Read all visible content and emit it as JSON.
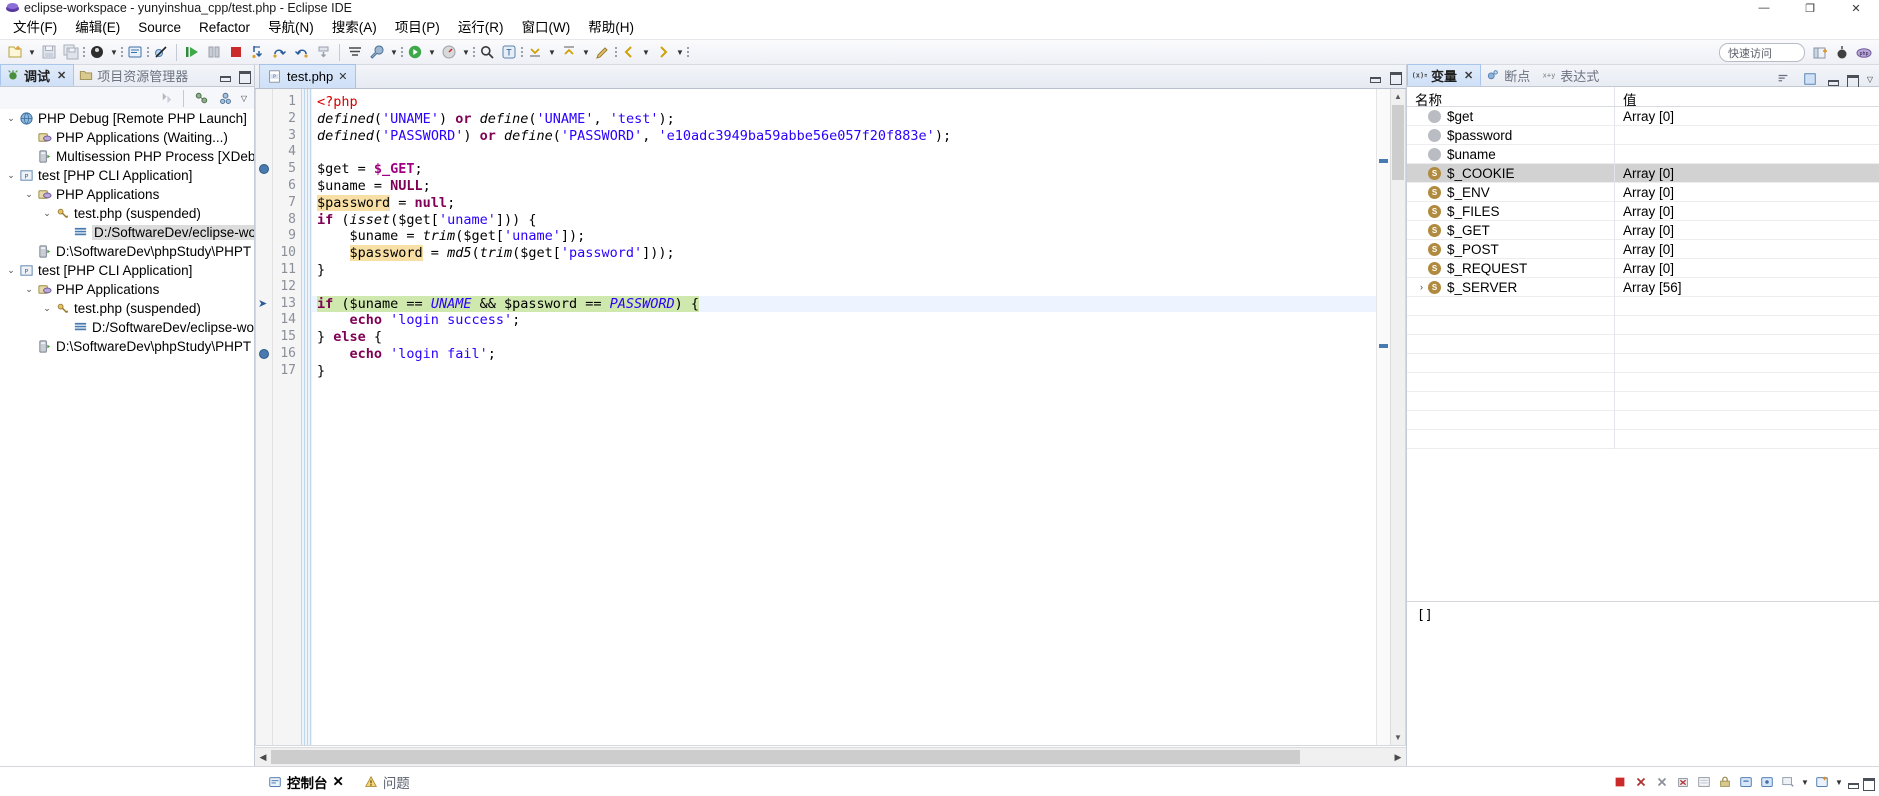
{
  "window": {
    "title": "eclipse-workspace - yunyinshua_cpp/test.php - Eclipse IDE",
    "minimize_label": "—",
    "maximize_label": "❐",
    "close_label": "✕"
  },
  "menu": {
    "items": [
      {
        "label": "文件(F)"
      },
      {
        "label": "编辑(E)"
      },
      {
        "label": "Source"
      },
      {
        "label": "Refactor"
      },
      {
        "label": "导航(N)"
      },
      {
        "label": "搜索(A)"
      },
      {
        "label": "项目(P)"
      },
      {
        "label": "运行(R)"
      },
      {
        "label": "窗口(W)"
      },
      {
        "label": "帮助(H)"
      }
    ]
  },
  "toolbar": {
    "quick_access": "快速访问",
    "icons": [
      "new-wizard-icon",
      "new-dropdown-icon",
      "save-icon",
      "save-all-icon",
      "debug-icon",
      "debug-dropdown-icon",
      "open-console-icon",
      "skip-breakpoints-icon",
      "resume-icon",
      "suspend-icon",
      "terminate-icon",
      "step-into-icon",
      "step-over-icon",
      "step-return-icon",
      "drop-to-frame-icon",
      "use-step-filters-icon",
      "run-icon",
      "external-tools-icon",
      "search-icon",
      "open-type-icon",
      "next-annotation-icon",
      "previous-annotation-icon",
      "last-edit-location-icon",
      "back-icon",
      "forward-icon",
      "pin-editor-icon"
    ]
  },
  "debug_view": {
    "tabs": [
      {
        "label": "调试",
        "icon": "bug-icon",
        "active": true,
        "closeable": true
      },
      {
        "label": "项目资源管理器",
        "icon": "project-explorer-icon",
        "active": false,
        "closeable": false
      }
    ],
    "tree": [
      {
        "indent": 0,
        "twist": "⌄",
        "icon": "launch-globe-icon",
        "label": "PHP Debug [Remote PHP Launch]",
        "selected": false
      },
      {
        "indent": 1,
        "twist": "",
        "icon": "php-apps-icon",
        "label": "PHP Applications (Waiting...)",
        "selected": false
      },
      {
        "indent": 1,
        "twist": "",
        "icon": "process-icon",
        "label": "Multisession PHP Process [XDebu",
        "selected": false
      },
      {
        "indent": 0,
        "twist": "⌄",
        "icon": "launch-config-icon",
        "label": "test [PHP CLI Application]",
        "selected": false
      },
      {
        "indent": 1,
        "twist": "⌄",
        "icon": "php-apps-icon",
        "label": "PHP Applications",
        "selected": false
      },
      {
        "indent": 2,
        "twist": "⌄",
        "icon": "thread-icon",
        "label": "test.php (suspended)",
        "selected": false
      },
      {
        "indent": 3,
        "twist": "",
        "icon": "stackframe-icon",
        "label": "D:/SoftwareDev/eclipse-wo",
        "selected": true
      },
      {
        "indent": 1,
        "twist": "",
        "icon": "process-icon",
        "label": "D:\\SoftwareDev\\phpStudy\\PHPT",
        "selected": false
      },
      {
        "indent": 0,
        "twist": "⌄",
        "icon": "launch-config-icon",
        "label": "test [PHP CLI Application]",
        "selected": false
      },
      {
        "indent": 1,
        "twist": "⌄",
        "icon": "php-apps-icon",
        "label": "PHP Applications",
        "selected": false
      },
      {
        "indent": 2,
        "twist": "⌄",
        "icon": "thread-icon",
        "label": "test.php (suspended)",
        "selected": false
      },
      {
        "indent": 3,
        "twist": "",
        "icon": "stackframe-icon",
        "label": "D:/SoftwareDev/eclipse-wo",
        "selected": false
      },
      {
        "indent": 1,
        "twist": "",
        "icon": "process-icon",
        "label": "D:\\SoftwareDev\\phpStudy\\PHPT",
        "selected": false
      }
    ]
  },
  "editor": {
    "tab": {
      "label": "test.php",
      "icon": "php-file-icon",
      "close": "✕"
    },
    "current_line": 13,
    "breakpoint_lines": [
      5,
      16
    ],
    "lines": [
      {
        "n": 1,
        "text": "<?php"
      },
      {
        "n": 2,
        "text": "defined('UNAME') or define('UNAME', 'test');"
      },
      {
        "n": 3,
        "text": "defined('PASSWORD') or define('PASSWORD', 'e10adc3949ba59abbe56e057f20f883e');"
      },
      {
        "n": 4,
        "text": ""
      },
      {
        "n": 5,
        "text": "$get = $_GET;"
      },
      {
        "n": 6,
        "text": "$uname = NULL;"
      },
      {
        "n": 7,
        "text": "$password = null;"
      },
      {
        "n": 8,
        "text": "if (isset($get['uname'])) {"
      },
      {
        "n": 9,
        "text": "    $uname = trim($get['uname']);"
      },
      {
        "n": 10,
        "text": "    $password = md5(trim($get['password']));"
      },
      {
        "n": 11,
        "text": "}"
      },
      {
        "n": 12,
        "text": ""
      },
      {
        "n": 13,
        "text": "if ($uname == UNAME && $password == PASSWORD) {"
      },
      {
        "n": 14,
        "text": "    echo 'login success';"
      },
      {
        "n": 15,
        "text": "} else {"
      },
      {
        "n": 16,
        "text": "    echo 'login fail';"
      },
      {
        "n": 17,
        "text": "}"
      }
    ]
  },
  "variables_view": {
    "tabs": [
      {
        "label": "变量",
        "icon": "variables-icon",
        "active": true,
        "closeable": true
      },
      {
        "label": "断点",
        "icon": "breakpoints-icon",
        "active": false,
        "closeable": false
      },
      {
        "label": "表达式",
        "icon": "expressions-icon",
        "active": false,
        "closeable": false
      }
    ],
    "columns": [
      "名称",
      "值"
    ],
    "rows": [
      {
        "twist": "",
        "icon": "gray",
        "name": "$get",
        "value": "Array [0]",
        "selected": false
      },
      {
        "twist": "",
        "icon": "gray",
        "name": "$password",
        "value": "",
        "selected": false
      },
      {
        "twist": "",
        "icon": "gray",
        "name": "$uname",
        "value": "",
        "selected": false
      },
      {
        "twist": "",
        "icon": "gold",
        "name": "$_COOKIE",
        "value": "Array [0]",
        "selected": true
      },
      {
        "twist": "",
        "icon": "gold",
        "name": "$_ENV",
        "value": "Array [0]",
        "selected": false
      },
      {
        "twist": "",
        "icon": "gold",
        "name": "$_FILES",
        "value": "Array [0]",
        "selected": false
      },
      {
        "twist": "",
        "icon": "gold",
        "name": "$_GET",
        "value": "Array [0]",
        "selected": false
      },
      {
        "twist": "",
        "icon": "gold",
        "name": "$_POST",
        "value": "Array [0]",
        "selected": false
      },
      {
        "twist": "",
        "icon": "gold",
        "name": "$_REQUEST",
        "value": "Array [0]",
        "selected": false
      },
      {
        "twist": "›",
        "icon": "gold",
        "name": "$_SERVER",
        "value": "Array [56]",
        "selected": false
      }
    ],
    "detail_value": "[]"
  },
  "bottom": {
    "tabs": [
      {
        "label": "控制台",
        "icon": "console-icon",
        "active": true,
        "closeable": true
      },
      {
        "label": "问题",
        "icon": "problems-icon",
        "active": false,
        "closeable": false
      }
    ],
    "tools": [
      "terminate-icon",
      "terminate-all-icon",
      "remove-launch-icon",
      "remove-all-terminated-icon",
      "clear-console-icon",
      "scroll-lock-icon",
      "show-console-on-output-icon",
      "pin-console-icon",
      "display-selected-console-icon",
      "open-console-icon",
      "minimize-icon",
      "maximize-icon"
    ]
  },
  "colors": {
    "accent": "#cfe0f7",
    "selection": "#d2d2d2",
    "current_line": "#eef4ff",
    "occurrence_highlight": "#f7dfa5",
    "debug_statement": "#cfe8ae",
    "keyword": "#7f0055",
    "string": "#2a00ff",
    "superglobal": "#a0007f",
    "php_tag": "#d60000"
  }
}
